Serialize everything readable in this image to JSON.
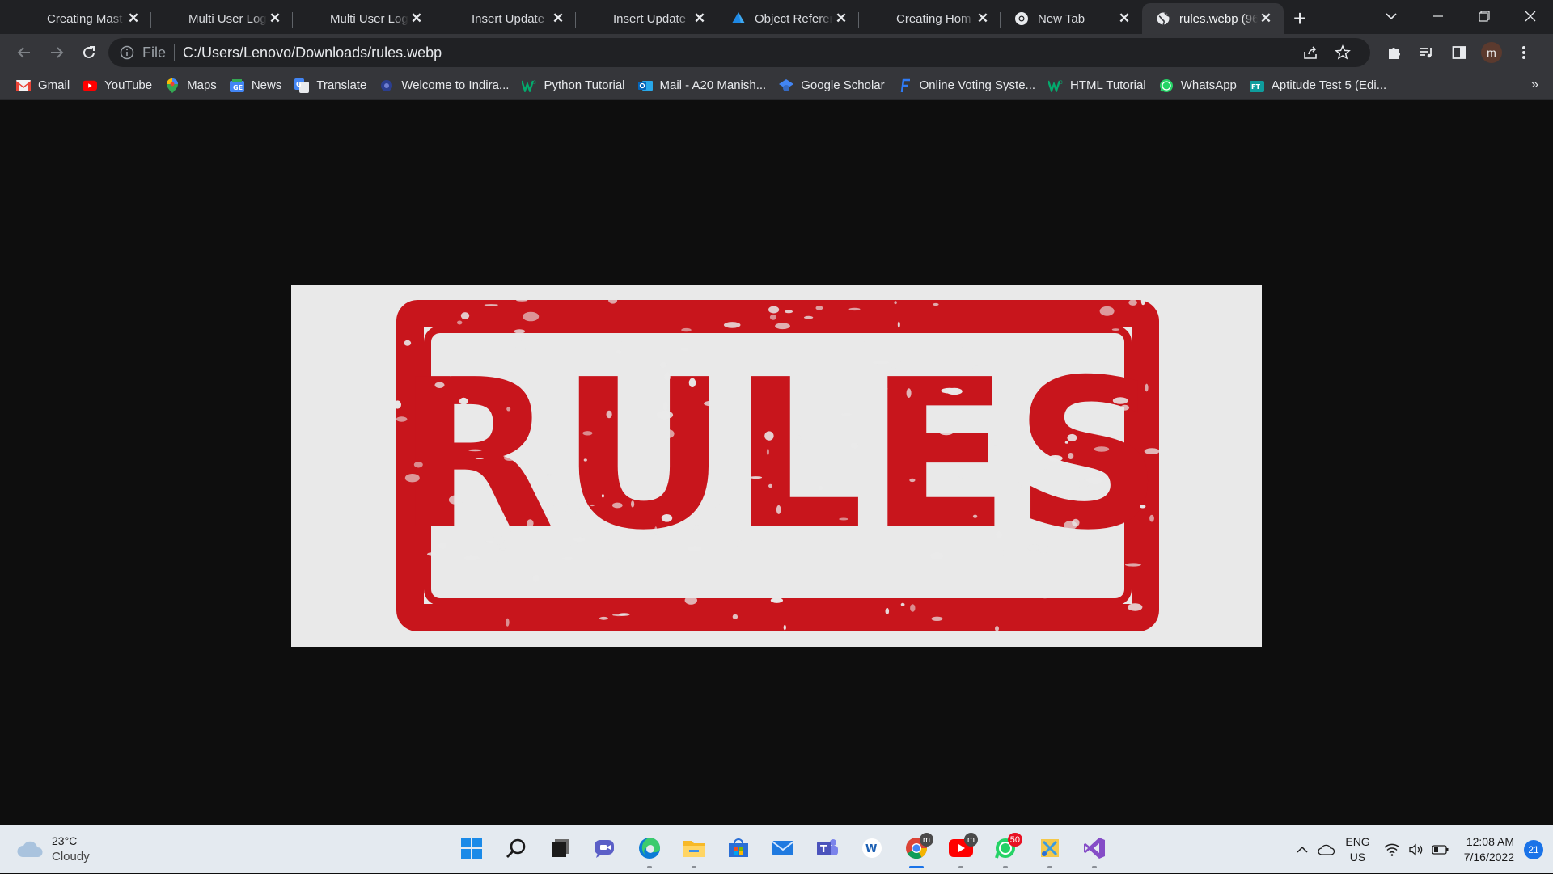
{
  "browser": {
    "tabs": [
      {
        "title": "Creating Mast",
        "favicon": "blank-icon",
        "active": false
      },
      {
        "title": "Multi User Log",
        "favicon": "blank-icon",
        "active": false
      },
      {
        "title": "Multi User Log",
        "favicon": "blank-icon",
        "active": false
      },
      {
        "title": "Insert Update",
        "favicon": "blank-icon",
        "active": false
      },
      {
        "title": "Insert Update",
        "favicon": "blank-icon",
        "active": false
      },
      {
        "title": "Object Referen",
        "favicon": "azure-icon",
        "active": false
      },
      {
        "title": "Creating Hom",
        "favicon": "blank-icon",
        "active": false
      },
      {
        "title": "New Tab",
        "favicon": "chrome-icon",
        "active": false
      },
      {
        "title": "rules.webp (96",
        "favicon": "globe-icon",
        "active": true
      }
    ],
    "close_glyph": "✕",
    "new_tab_glyph": "+",
    "omnibox": {
      "protocol_label": "File",
      "url": "C:/Users/Lenovo/Downloads/rules.webp"
    },
    "profile_initial": "m",
    "bookmarks": [
      {
        "label": "Gmail",
        "icon": "gmail-icon"
      },
      {
        "label": "YouTube",
        "icon": "youtube-icon"
      },
      {
        "label": "Maps",
        "icon": "maps-icon"
      },
      {
        "label": "News",
        "icon": "news-icon"
      },
      {
        "label": "Translate",
        "icon": "translate-icon"
      },
      {
        "label": "Welcome to Indira...",
        "icon": "emblem-icon"
      },
      {
        "label": "Python Tutorial",
        "icon": "w3schools-icon"
      },
      {
        "label": "Mail - A20 Manish...",
        "icon": "outlook-icon"
      },
      {
        "label": "Google Scholar",
        "icon": "scholar-icon"
      },
      {
        "label": "Online Voting Syste...",
        "icon": "f-icon"
      },
      {
        "label": "HTML Tutorial",
        "icon": "w3schools-icon"
      },
      {
        "label": "WhatsApp",
        "icon": "whatsapp-icon"
      },
      {
        "label": "Aptitude Test 5 (Edi...",
        "icon": "forms-icon"
      }
    ],
    "bookmarks_more": "»"
  },
  "content": {
    "image_word": "RULES",
    "stamp_color": "#c8151c"
  },
  "taskbar": {
    "weather": {
      "temp": "23°C",
      "condition": "Cloudy"
    },
    "apps": [
      {
        "name": "start-icon"
      },
      {
        "name": "search-icon"
      },
      {
        "name": "task-view-icon"
      },
      {
        "name": "chat-icon"
      },
      {
        "name": "edge-icon",
        "running": true
      },
      {
        "name": "file-explorer-icon",
        "running": true
      },
      {
        "name": "store-icon"
      },
      {
        "name": "mail-icon"
      },
      {
        "name": "teams-icon"
      },
      {
        "name": "word-icon"
      },
      {
        "name": "chrome-icon",
        "running": true,
        "active": true,
        "badge": "m"
      },
      {
        "name": "youtube-app-icon",
        "running": true,
        "badge": "m"
      },
      {
        "name": "whatsapp-app-icon",
        "running": true,
        "badge": "50"
      },
      {
        "name": "snipping-icon",
        "running": true
      },
      {
        "name": "visual-studio-icon",
        "running": true
      }
    ],
    "language": {
      "line1": "ENG",
      "line2": "US"
    },
    "clock": {
      "time": "12:08 AM",
      "date": "7/16/2022"
    },
    "notifications": "21"
  }
}
